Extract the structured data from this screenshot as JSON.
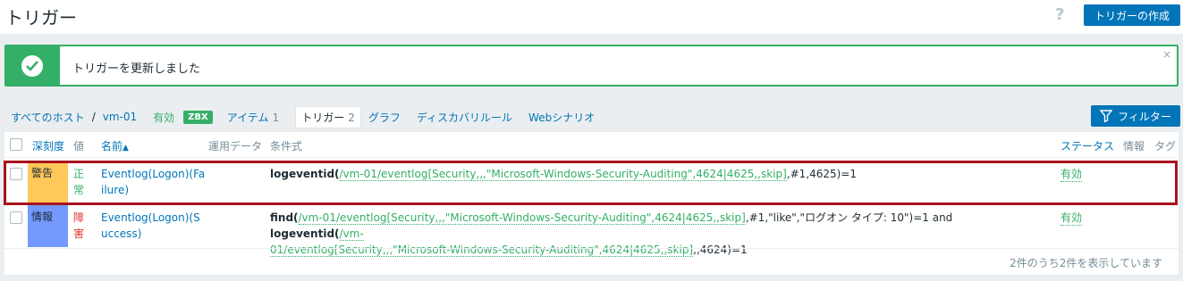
{
  "header": {
    "title": "トリガー",
    "help_icon": "?",
    "create_label": "トリガーの作成"
  },
  "message": {
    "text": "トリガーを更新しました",
    "close": "×"
  },
  "nav": {
    "all_hosts": "すべてのホスト",
    "separator": "/",
    "host": "vm-01",
    "status": "有効",
    "zbx_badge": "ZBX",
    "items_label": "アイテム",
    "items_count": "1",
    "triggers_label": "トリガー",
    "triggers_count": "2",
    "graphs": "グラフ",
    "discovery": "ディスカバリルール",
    "web": "Webシナリオ"
  },
  "filter_label": "フィルター",
  "table": {
    "headers": {
      "severity": "深刻度",
      "value": "値",
      "name": "名前",
      "sort_arrow": "▲",
      "operational_data": "運用データ",
      "expression": "条件式",
      "status": "ステータス",
      "info": "情報",
      "tags": "タグ"
    },
    "rows": [
      {
        "severity": "警告",
        "severity_color": "#ffc859",
        "value": "正常",
        "value_color": "#34af67",
        "name": "Eventlog(Logon)(Failure)",
        "expr": {
          "fn": "logeventid",
          "open": "(",
          "item": "/vm-01/eventlog[Security,,,\"Microsoft-Windows-Security-Auditing\",4624|4625,,skip]",
          "rest": ",#1,4625)=1"
        },
        "status": "有効"
      },
      {
        "severity": "情報",
        "severity_color": "#7499ff",
        "value": "障害",
        "value_color": "#e33734",
        "name": "Eventlog(Logon)(Success)",
        "expr": {
          "fn1": "find",
          "open1": "(",
          "item1_a": "/vm-01/eventlog[Security,,,\"Microsoft-Windows-Security-Auditing\",4624|4625,,skip]",
          "rest1": ",#1,\"like\",\"ログオン タイプ: 10\")=1 and ",
          "fn2": "logeventid",
          "open2": "(",
          "item2_a": "/vm-",
          "item2_b": "01/eventlog[Security,,,\"Microsoft-Windows-Security-Auditing\",4624|4625,,skip]",
          "rest2": ",,4624)=1"
        },
        "status": "有効"
      }
    ],
    "footer": "2件のうち2件を表示しています"
  }
}
